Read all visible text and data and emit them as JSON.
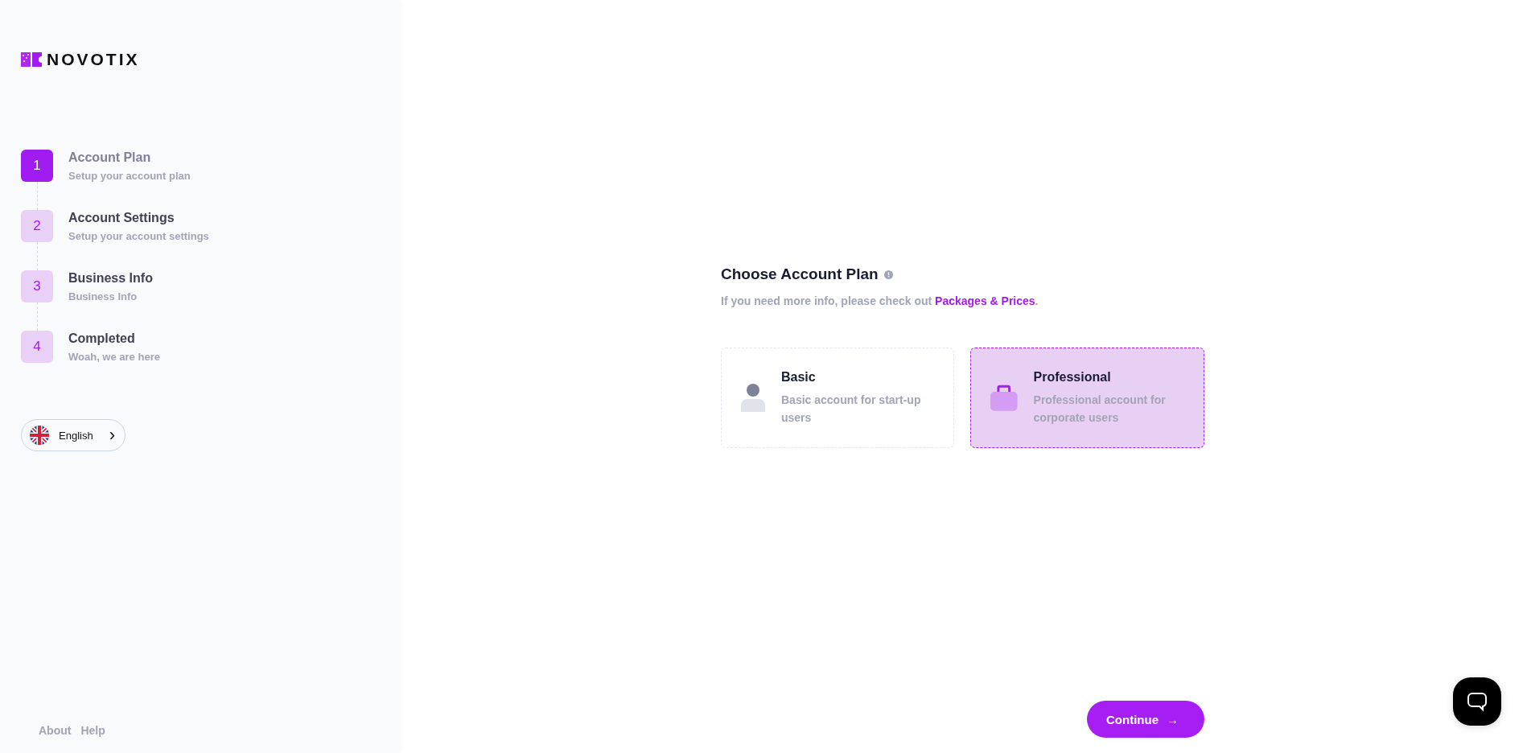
{
  "logo": {
    "text": "NOVOTIX"
  },
  "steps": [
    {
      "number": "1",
      "title": "Account Plan",
      "subtitle": "Setup your account plan",
      "selected": true
    },
    {
      "number": "2",
      "title": "Account Settings",
      "subtitle": "Setup your account settings",
      "selected": false
    },
    {
      "number": "3",
      "title": "Business Info",
      "subtitle": "Business Info",
      "selected": false
    },
    {
      "number": "4",
      "title": "Completed",
      "subtitle": "Woah, we are here",
      "selected": false
    }
  ],
  "language": {
    "label": "English",
    "caret": "›"
  },
  "footer_links": [
    "About",
    "Help"
  ],
  "heading": {
    "title": "Choose Account Plan",
    "subtitle": "If you need more info, please check out",
    "link": "Packages & Prices",
    "after": "."
  },
  "plans": [
    {
      "kind": "person",
      "title": "Basic",
      "description": "Basic account for start-up users",
      "selected": false
    },
    {
      "kind": "briefcase",
      "title": "Professional",
      "description": "Professional account for corporate users",
      "selected": true
    }
  ],
  "continue_button": {
    "label": "Continue",
    "arrow": "→"
  }
}
